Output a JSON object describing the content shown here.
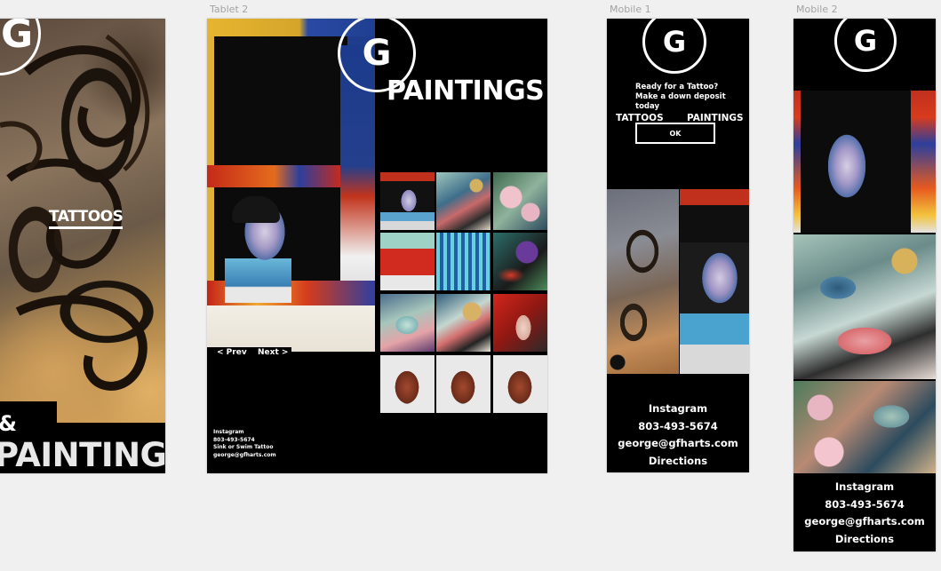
{
  "artboards": {
    "tablet_label": "Tablet 2",
    "mobile1_label": "Mobile 1",
    "mobile2_label": "Mobile 2"
  },
  "brand": {
    "logo_letter": "G"
  },
  "desktop": {
    "tattoos_label": "TATTOOS",
    "amp": "&",
    "paintings_label": "PAINTINGS"
  },
  "tablet": {
    "title": "PAINTINGS",
    "prev": "< Prev",
    "next": "Next >",
    "contact": [
      "Instagram",
      "803-493-5674",
      "Sink or Swim Tattoo",
      "george@gfharts.com"
    ]
  },
  "mobile1": {
    "prompt": "Ready for a Tattoo? Make a down deposit today",
    "ok": "OK",
    "tile_tattoos": "TATTOOS",
    "tile_paintings": "PAINTINGS",
    "contact": [
      "Instagram",
      "803-493-5674",
      "george@gfharts.com",
      "Directions"
    ]
  },
  "mobile2": {
    "contact": [
      "Instagram",
      "803-493-5674",
      "george@gfharts.com",
      "Directions"
    ]
  },
  "colors": {
    "canvas": "#f0f0f0",
    "frame": "#000000",
    "text": "#ffffff",
    "label": "#a3a3a3"
  },
  "thumbnails": [
    {
      "name": "portrait-painting"
    },
    {
      "name": "abstract-swirl-painting"
    },
    {
      "name": "rose-painting"
    },
    {
      "name": "red-abstract-painting"
    },
    {
      "name": "blue-drip-painting"
    },
    {
      "name": "purple-grapes-painting"
    },
    {
      "name": "teal-abstract-painting"
    },
    {
      "name": "skull-painting"
    },
    {
      "name": "red-figure-painting"
    },
    {
      "name": "screaming-face-1"
    },
    {
      "name": "screaming-face-2"
    },
    {
      "name": "screaming-face-3"
    }
  ]
}
